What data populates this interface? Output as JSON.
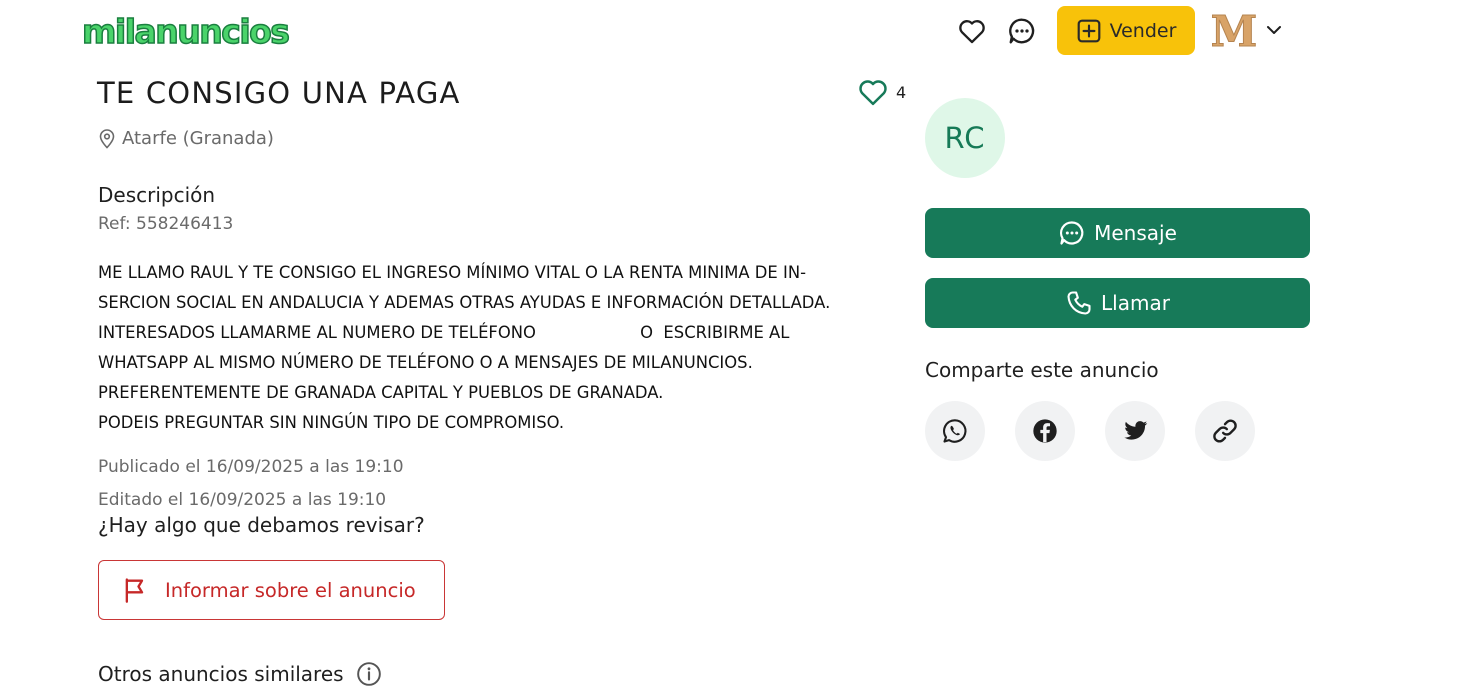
{
  "header": {
    "logo_text": "milanuncios",
    "sell_label": "Vender",
    "avatar_letter": "M",
    "icons": [
      "heart-icon",
      "chat-icon",
      "plus-square-icon",
      "chevron-down-icon"
    ]
  },
  "ad": {
    "title": "TE CONSIGO UNA PAGA",
    "favorites_count": "4",
    "location": "Atarfe (Granada)",
    "description_heading": "Descripción",
    "reference": "Ref: 558246413",
    "description_lines": [
      "ME LLAMO RAUL Y TE CONSIGO EL INGRESO MÍNIMO VITAL O LA RENTA MINIMA DE IN-",
      "SERCION SOCIAL EN ANDALUCIA Y ADEMAS OTRAS AYUDAS E INFORMACIÓN DETALLADA.",
      "INTERESADOS LLAMARME AL NUMERO DE TELÉFONO                    O  ESCRIBIRME AL",
      "WHATSAPP AL MISMO NÚMERO DE TELÉFONO O A MENSAJES DE MILANUNCIOS.",
      "PREFERENTEMENTE DE GRANADA CAPITAL Y PUEBLOS DE GRANADA.",
      "PODEIS PREGUNTAR SIN NINGÚN TIPO DE COMPROMISO."
    ],
    "published": "Publicado el 16/09/2025 a las 19:10",
    "edited": "Editado el 16/09/2025 a las 19:10",
    "review_question": "¿Hay algo que debamos revisar?",
    "report_label": "Informar sobre el anuncio",
    "similar_label": "Otros anuncios similares"
  },
  "seller": {
    "initials": "RC",
    "message_label": "Mensaje",
    "call_label": "Llamar",
    "share_heading": "Comparte este anuncio",
    "share_icons": [
      "whatsapp-icon",
      "facebook-icon",
      "twitter-icon",
      "link-icon"
    ]
  },
  "colors": {
    "logo_green": "#4ad36a",
    "primary_green": "#177a59",
    "sell_yellow": "#f8c20a",
    "report_red": "#c62828",
    "avatar_bg": "#dff7e8"
  }
}
